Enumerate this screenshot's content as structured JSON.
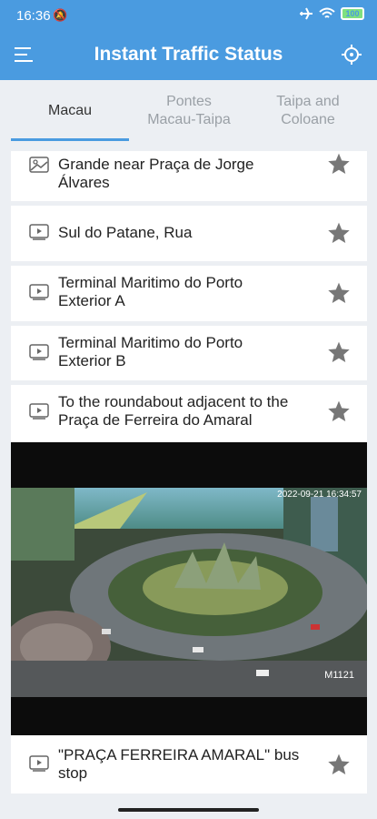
{
  "status_bar": {
    "time": "16:36",
    "battery": "100"
  },
  "app_bar": {
    "title": "Instant Traffic Status"
  },
  "tabs": [
    {
      "label": "Macau"
    },
    {
      "label": "Pontes\nMacau-Taipa"
    },
    {
      "label": "Taipa and\nColoane"
    }
  ],
  "list": [
    {
      "line1": "Grande near Praça de Jorge",
      "line2": "Álvares",
      "icon": "image-icon"
    },
    {
      "line1": "Sul do Patane, Rua",
      "line2": "",
      "icon": "video-icon"
    },
    {
      "line1": "Terminal Maritimo do Porto",
      "line2": "Exterior A",
      "icon": "video-icon"
    },
    {
      "line1": "Terminal Maritimo do Porto",
      "line2": "Exterior B",
      "icon": "video-icon"
    },
    {
      "line1": "To the roundabout adjacent to the",
      "line2": "Praça de Ferreira do Amaral",
      "icon": "video-icon"
    },
    {
      "line1": "\"PRAÇA FERREIRA AMARAL\" bus",
      "line2": "stop",
      "icon": "video-icon"
    }
  ],
  "camera": {
    "timestamp": "2022-09-21 16:34:57",
    "camera_id": "M1121"
  }
}
